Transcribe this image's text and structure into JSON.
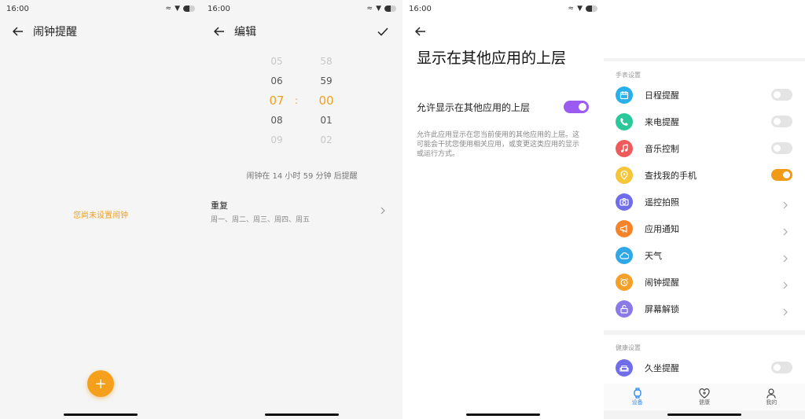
{
  "status": {
    "time": "16:00"
  },
  "screen1": {
    "title": "闹钟提醒",
    "empty_text": "您尚未设置闹钟",
    "fab_label": "+"
  },
  "screen2": {
    "title": "编辑",
    "hours": [
      "05",
      "06",
      "07",
      "08",
      "09"
    ],
    "minutes": [
      "58",
      "59",
      "00",
      "01",
      "02"
    ],
    "separator": ":",
    "hint": "闹钟在 14 小时 59 分钟 后提醒",
    "repeat_title": "重复",
    "repeat_days": "周一、周二、周三、周四、周五"
  },
  "screen3": {
    "title": "显示在其他应用的上层",
    "toggle_label": "允许显示在其他应用的上层",
    "toggle_on": true,
    "description": "允许此应用显示在您当前使用的其他应用的上层。这可能会干扰您使用相关应用，或变更这类应用的显示或运行方式。",
    "accent": "#9a5cf0"
  },
  "screen4": {
    "section_watch": "手表设置",
    "items": [
      {
        "label": "日程提醒",
        "icon": "calendar-icon",
        "color": "#2ab0e8",
        "control": "toggle",
        "on": false
      },
      {
        "label": "来电提醒",
        "icon": "phone-icon",
        "color": "#2cc79a",
        "control": "toggle",
        "on": false
      },
      {
        "label": "音乐控制",
        "icon": "music-icon",
        "color": "#ef5a5a",
        "control": "toggle",
        "on": false
      },
      {
        "label": "查找我的手机",
        "icon": "location-icon",
        "color": "#f5c53a",
        "control": "toggle",
        "on": true
      },
      {
        "label": "遥控拍照",
        "icon": "camera-icon",
        "color": "#6f6ee8",
        "control": "chevron"
      },
      {
        "label": "应用通知",
        "icon": "megaphone-icon",
        "color": "#f5832a",
        "control": "chevron"
      },
      {
        "label": "天气",
        "icon": "weather-icon",
        "color": "#30a8e8",
        "control": "chevron"
      },
      {
        "label": "闹钟提醒",
        "icon": "alarm-icon",
        "color": "#f5a02a",
        "control": "chevron"
      },
      {
        "label": "屏幕解锁",
        "icon": "unlock-icon",
        "color": "#8a7ae8",
        "control": "chevron"
      }
    ],
    "section_health": "健康设置",
    "health_items": [
      {
        "label": "久坐提醒",
        "icon": "sofa-icon",
        "color": "#6f6ee8",
        "control": "toggle",
        "on": false
      }
    ],
    "nav": [
      {
        "label": "设备",
        "icon": "watch-icon",
        "active": true
      },
      {
        "label": "健康",
        "icon": "heart-icon",
        "active": false
      },
      {
        "label": "我的",
        "icon": "person-icon",
        "active": false
      }
    ],
    "toggle_on_color": "#f09a18"
  }
}
